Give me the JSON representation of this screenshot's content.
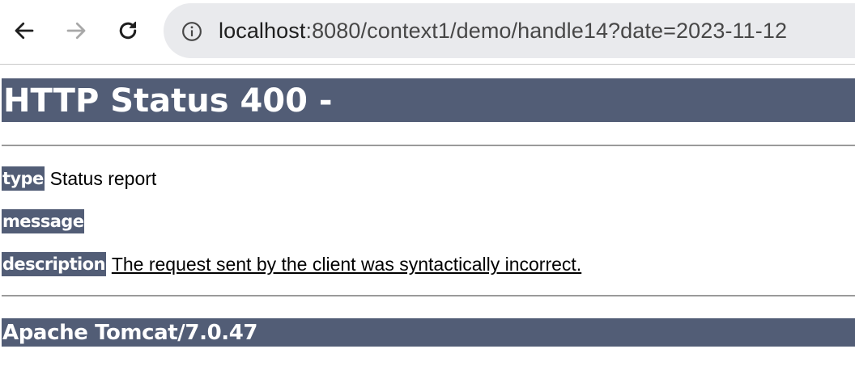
{
  "browser": {
    "url_host": "localhost",
    "url_rest": ":8080/context1/demo/handle14?date=2023-11-12",
    "icons": {
      "back": "arrow-left-icon",
      "forward": "arrow-right-icon",
      "reload": "reload-icon",
      "site_info": "info-circle-icon"
    }
  },
  "page": {
    "title": "HTTP Status 400 -",
    "type_label": "type",
    "type_value": "Status report",
    "message_label": "message",
    "message_value": "",
    "description_label": "description",
    "description_value": "The request sent by the client was syntactically incorrect.",
    "footer": "Apache Tomcat/7.0.47"
  },
  "colors": {
    "header_bg": "#525d76",
    "header_text": "#ffffff",
    "omnibox_bg": "#e9eaed"
  }
}
